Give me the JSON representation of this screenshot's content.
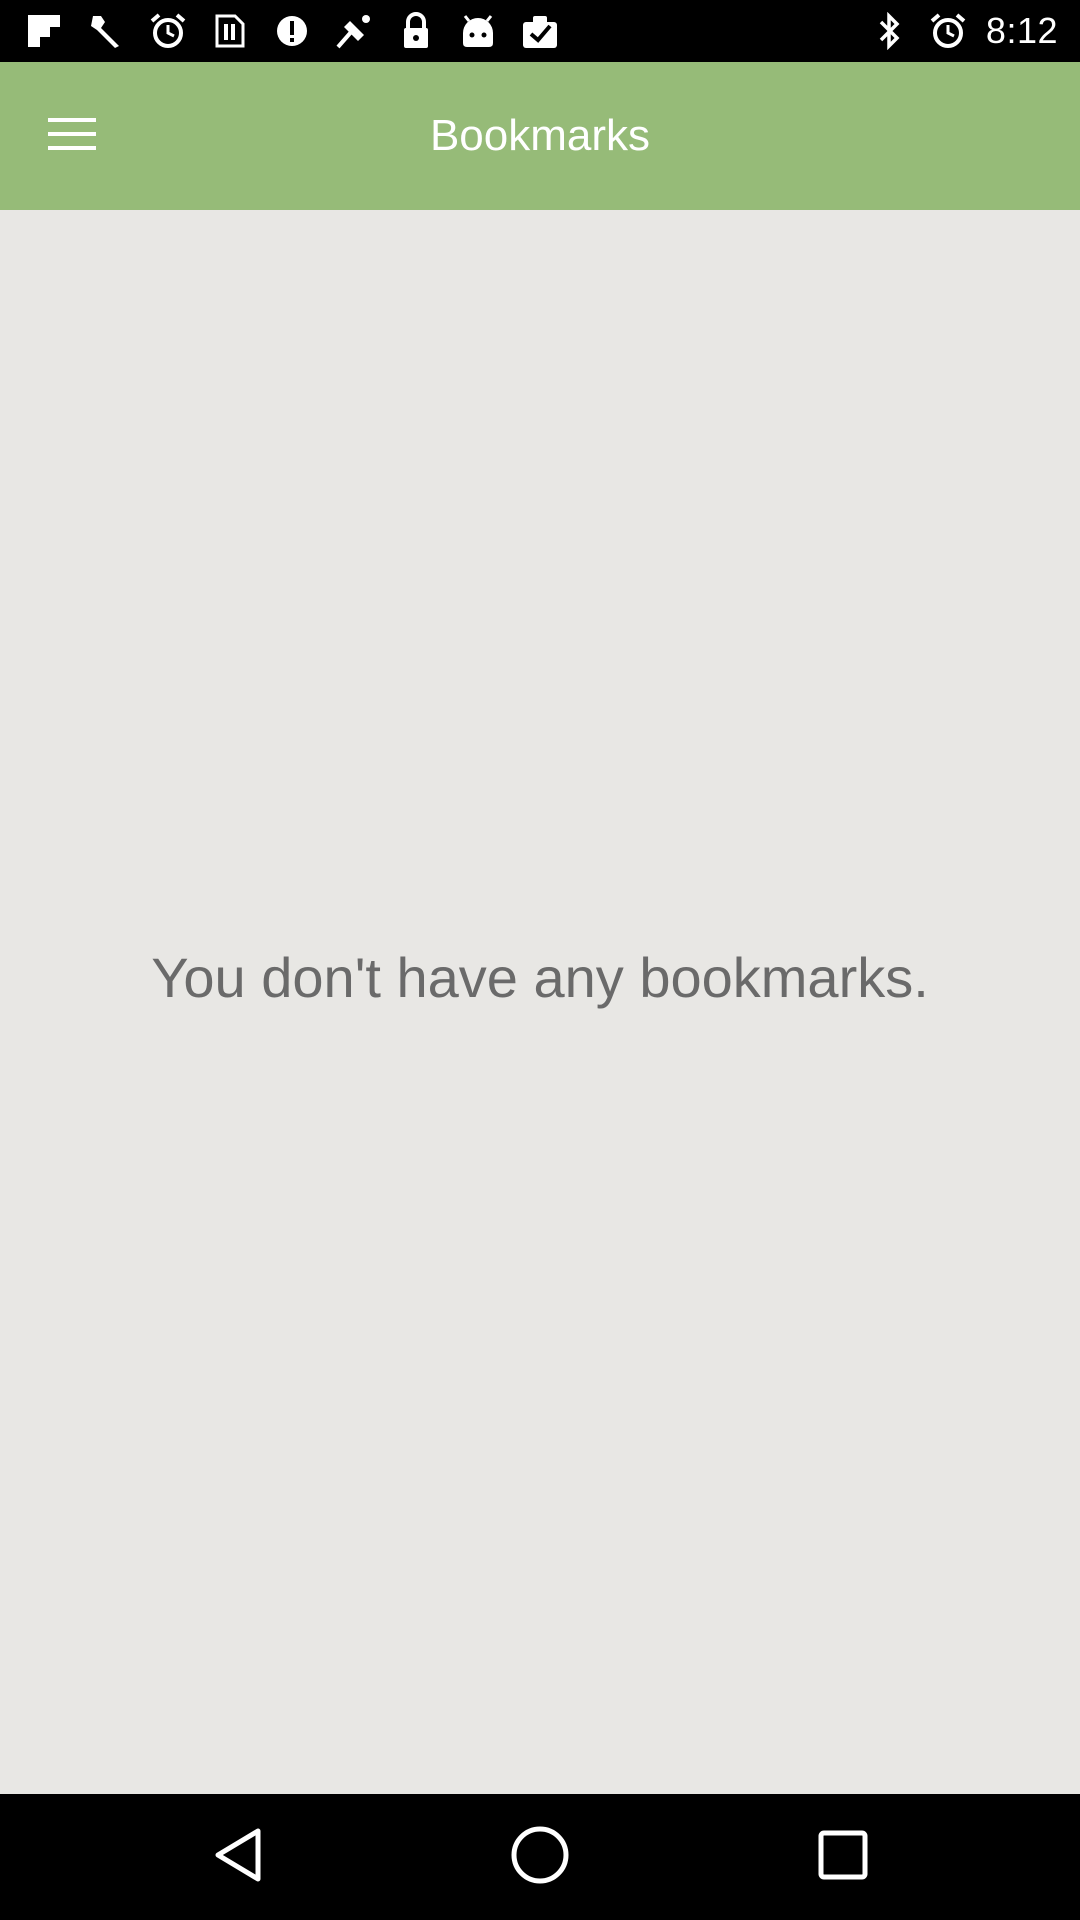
{
  "status_bar": {
    "time": "8:12",
    "left_icons": [
      "flipboard-icon",
      "wrench-icon",
      "alarm-icon",
      "sim-card-icon",
      "data-saver-icon",
      "fake-gps-icon",
      "lock-icon",
      "android-icon",
      "clipboard-check-icon"
    ],
    "right_icons": [
      "bluetooth-icon",
      "alarm-icon"
    ]
  },
  "app_bar": {
    "title": "Bookmarks",
    "background": "#96bb78"
  },
  "main": {
    "empty_message": "You don't have any bookmarks.",
    "background": "#e8e7e4"
  },
  "nav_bar": {
    "buttons": [
      "back-icon",
      "home-icon",
      "recents-icon"
    ]
  }
}
